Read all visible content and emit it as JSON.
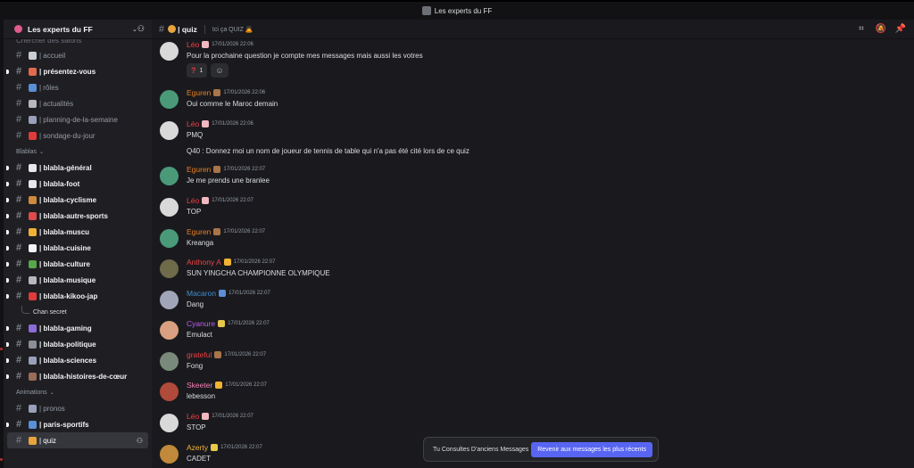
{
  "window": {
    "title": "Les experts du FF"
  },
  "server": {
    "name": "Les experts du FF",
    "search_stub": "Chercher des salons"
  },
  "channels_top": [
    {
      "label": "| accueil",
      "emoji_color": "#c9cdd4",
      "unread": false
    },
    {
      "label": "| présentez-vous",
      "emoji_color": "#e06a4c",
      "unread": true
    },
    {
      "label": "| rôles",
      "emoji_color": "#5b8fd6",
      "unread": false
    },
    {
      "label": "| actualités",
      "emoji_color": "#b7b9bf",
      "unread": false
    },
    {
      "label": "| planning-de-la-semaine",
      "emoji_color": "#9aa0b8",
      "unread": false
    },
    {
      "label": "| sondage-du-jour",
      "emoji_color": "#e03a3a",
      "unread": false
    }
  ],
  "category_blablas": {
    "label": "Blablas"
  },
  "channels_blablas": [
    {
      "label": "| blabla-général",
      "emoji_color": "#e8e8ec",
      "unread": true
    },
    {
      "label": "| blabla-foot",
      "emoji_color": "#e8e8ec",
      "unread": true
    },
    {
      "label": "| blabla-cyclisme",
      "emoji_color": "#d08a3c",
      "unread": true
    },
    {
      "label": "| blabla-autre-sports",
      "emoji_color": "#e04a4a",
      "unread": true
    },
    {
      "label": "| blabla-muscu",
      "emoji_color": "#f0b232",
      "unread": true
    },
    {
      "label": "| blabla-cuisine",
      "emoji_color": "#f2f3f5",
      "unread": true
    },
    {
      "label": "| blabla-culture",
      "emoji_color": "#58a64a",
      "unread": true
    },
    {
      "label": "| blabla-musique",
      "emoji_color": "#b7b9bf",
      "unread": true
    },
    {
      "label": "| blabla-kikoo-jap",
      "emoji_color": "#e03a3a",
      "unread": true
    }
  ],
  "thread": {
    "label": "Chan secret"
  },
  "channels_blablas_2": [
    {
      "label": "| blabla-gaming",
      "emoji_color": "#8c6cd6",
      "unread": true
    },
    {
      "label": "| blabla-politique",
      "emoji_color": "#8a8e96",
      "unread": true
    },
    {
      "label": "| blabla-sciences",
      "emoji_color": "#9aa0b8",
      "unread": true
    },
    {
      "label": "| blabla-histoires-de-cœur",
      "emoji_color": "#9a6c5a",
      "unread": true
    }
  ],
  "category_animations": {
    "label": "Animations"
  },
  "channels_animations": [
    {
      "label": "| pronos",
      "emoji_color": "#9aa0b8",
      "unread": false
    },
    {
      "label": "| paris-sportifs",
      "emoji_color": "#5b8fd6",
      "unread": true
    },
    {
      "label": "| quiz",
      "emoji_color": "#e8a43c",
      "unread": false,
      "active": true
    }
  ],
  "header": {
    "channel": "| quiz",
    "topic": "Ici ça QUIZ 🙇",
    "tools": [
      "threads-icon",
      "mute-icon",
      "pin-icon"
    ]
  },
  "messages": [
    {
      "author": "Léo",
      "color": "#f23f43",
      "badge_color": "#f2b8c0",
      "avatar_color": "#d9d9d9",
      "time": "17/01/2026 22:06",
      "text": "Pour la prochaine question je compte mes messages mais aussi les votres",
      "reactions": [
        {
          "emoji": "?",
          "count": "1"
        },
        {
          "emoji": "☺",
          "count": ""
        }
      ]
    },
    {
      "author": "Eguren",
      "color": "#e67e22",
      "badge_color": "#a8754a",
      "avatar_color": "#4a9a7a",
      "time": "17/01/2026 22:06",
      "text": "Oui comme le Maroc demain"
    },
    {
      "author": "Léo",
      "color": "#f23f43",
      "badge_color": "#f2b8c0",
      "avatar_color": "#d9d9d9",
      "time": "17/01/2026 22:06",
      "text": "PMQ",
      "text2": "Q40 : Donnez moi un nom de joueur de tennis de table qui n'a pas été cité lors de ce quiz"
    },
    {
      "author": "Eguren",
      "color": "#e67e22",
      "badge_color": "#a8754a",
      "avatar_color": "#4a9a7a",
      "time": "17/01/2026 22:07",
      "text": "Je me prends une branlee"
    },
    {
      "author": "Léo",
      "color": "#f23f43",
      "badge_color": "#f2b8c0",
      "avatar_color": "#d9d9d9",
      "time": "17/01/2026 22:07",
      "text": "TOP"
    },
    {
      "author": "Eguren",
      "color": "#e67e22",
      "badge_color": "#a8754a",
      "avatar_color": "#4a9a7a",
      "time": "17/01/2026 22:07",
      "text": "Kreanga"
    },
    {
      "author": "Anthony A",
      "color": "#f23f43",
      "badge_color": "#f0b232",
      "avatar_color": "#6e6a4a",
      "time": "17/01/2026 22:07",
      "text": "SUN YINGCHA CHAMPIONNE OLYMPIQUE"
    },
    {
      "author": "Macaron",
      "color": "#3e8ed0",
      "badge_color": "#5b8fd6",
      "avatar_color": "#a0a6b8",
      "time": "17/01/2026 22:07",
      "text": "Dang"
    },
    {
      "author": "Cyanure",
      "color": "#c05cf0",
      "badge_color": "#e8c84a",
      "avatar_color": "#d8a080",
      "time": "17/01/2026 22:07",
      "text": "Emulact"
    },
    {
      "author": "grateful",
      "color": "#f23f43",
      "badge_color": "#a8754a",
      "avatar_color": "#7a8a7a",
      "time": "17/01/2026 22:07",
      "text": "Fong"
    },
    {
      "author": "Skeeter",
      "color": "#f47fb5",
      "badge_color": "#f0b232",
      "avatar_color": "#b04a3a",
      "time": "17/01/2026 22:07",
      "text": "lebesson"
    },
    {
      "author": "Léo",
      "color": "#f23f43",
      "badge_color": "#f2b8c0",
      "avatar_color": "#d9d9d9",
      "time": "17/01/2026 22:07",
      "text": "STOP"
    },
    {
      "author": "Azerty",
      "color": "#f0b232",
      "badge_color": "#e8c84a",
      "avatar_color": "#c08a3a",
      "time": "17/01/2026 22:07",
      "text": "CADET"
    }
  ],
  "jump_bar": {
    "text": "Tu Consultes D'anciens Messages",
    "button": "Revenir aux messages les plus récents"
  }
}
